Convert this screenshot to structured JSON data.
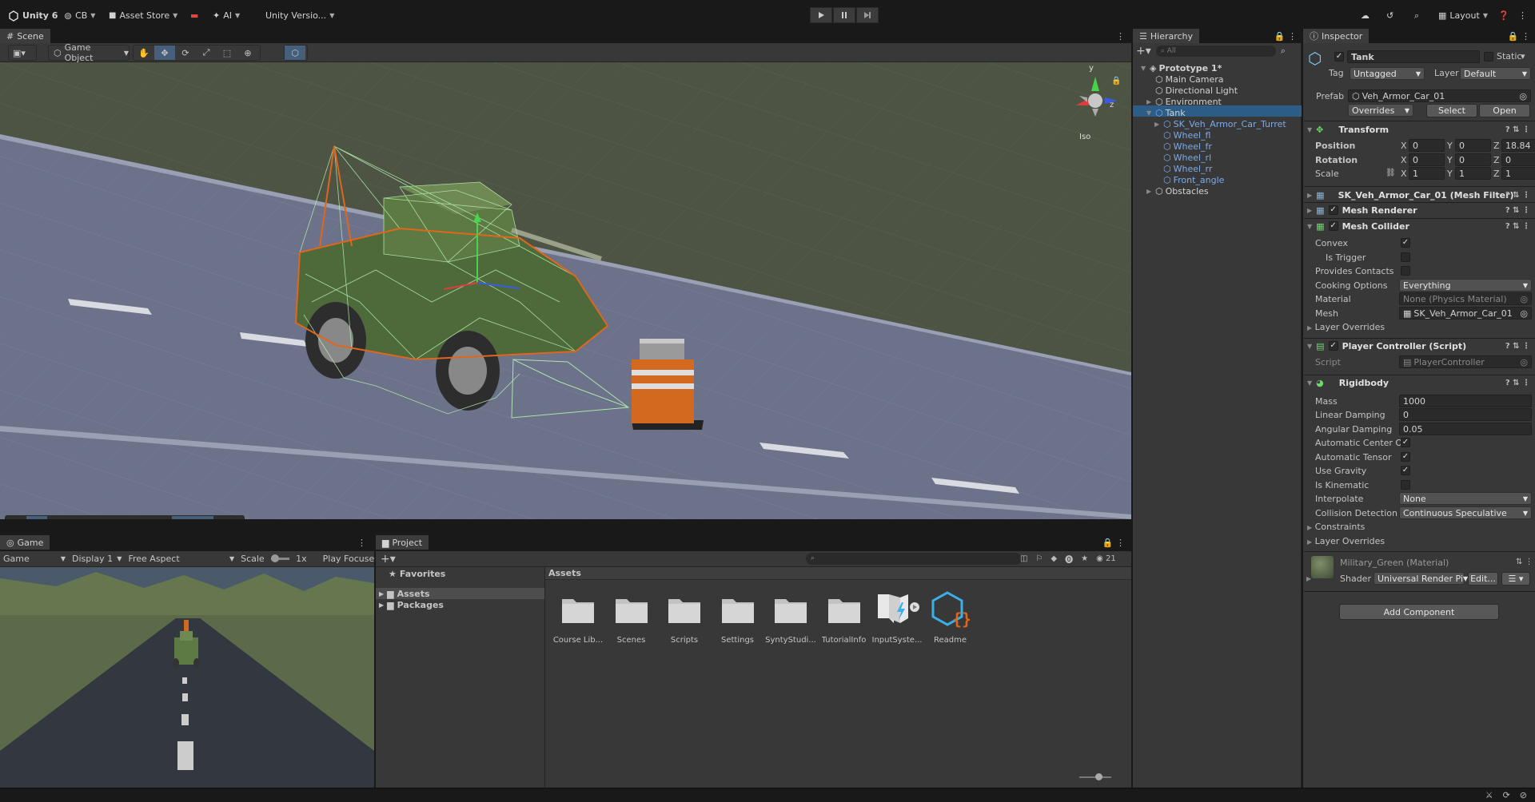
{
  "titlebar": {
    "app": "Unity 6",
    "account": "CB",
    "asset_store": "Asset Store",
    "ai": "AI",
    "version": "Unity Versio...",
    "layout": "Layout"
  },
  "scene": {
    "tab": "Scene",
    "game_object": "Game Object",
    "iso": "Iso",
    "gizmo_y": "y",
    "gizmo_z": "z"
  },
  "game": {
    "tab": "Game",
    "view": "Game",
    "display": "Display 1",
    "aspect": "Free Aspect",
    "scale_label": "Scale",
    "scale_value": "1x",
    "play_mode": "Play Focused"
  },
  "hierarchy": {
    "tab": "Hierarchy",
    "search_placeholder": "All",
    "items": [
      {
        "label": "Prototype 1*"
      },
      {
        "label": "Main Camera"
      },
      {
        "label": "Directional Light"
      },
      {
        "label": "Environment"
      },
      {
        "label": "Tank"
      },
      {
        "label": "SK_Veh_Armor_Car_Turret"
      },
      {
        "label": "Wheel_fl"
      },
      {
        "label": "Wheel_fr"
      },
      {
        "label": "Wheel_rl"
      },
      {
        "label": "Wheel_rr"
      },
      {
        "label": "Front_angle"
      },
      {
        "label": "Obstacles"
      }
    ]
  },
  "project": {
    "tab": "Project",
    "favorites": "Favorites",
    "tree": [
      "Assets",
      "Packages"
    ],
    "breadcrumb": "Assets",
    "count": "21",
    "assets": [
      {
        "name": "Course Lib...",
        "icon": "folder"
      },
      {
        "name": "Scenes",
        "icon": "folder"
      },
      {
        "name": "Scripts",
        "icon": "folder"
      },
      {
        "name": "Settings",
        "icon": "folder"
      },
      {
        "name": "SyntyStudi...",
        "icon": "folder"
      },
      {
        "name": "TutorialInfo",
        "icon": "folder"
      },
      {
        "name": "InputSyste...",
        "icon": "input-system"
      },
      {
        "name": "Readme",
        "icon": "readme"
      }
    ]
  },
  "inspector": {
    "tab": "Inspector",
    "name": "Tank",
    "static": "Static",
    "tag_label": "Tag",
    "tag": "Untagged",
    "layer_label": "Layer",
    "layer": "Default",
    "prefab_label": "Prefab",
    "prefab": "Veh_Armor_Car_01",
    "overrides": "Overrides",
    "select": "Select",
    "open": "Open",
    "transform": {
      "title": "Transform",
      "position": "Position",
      "rotation": "Rotation",
      "scale": "Scale",
      "x": "X",
      "y": "Y",
      "z": "Z",
      "pos": [
        "0",
        "0",
        "18.84"
      ],
      "rot": [
        "0",
        "0",
        "0"
      ],
      "scl": [
        "1",
        "1",
        "1"
      ]
    },
    "mesh_filter": "SK_Veh_Armor_Car_01 (Mesh Filter)",
    "mesh_renderer": "Mesh Renderer",
    "mesh_collider": {
      "title": "Mesh Collider",
      "convex": "Convex",
      "is_trigger": "Is Trigger",
      "provides_contacts": "Provides Contacts",
      "cooking_options": "Cooking Options",
      "cooking_value": "Everything",
      "material": "Material",
      "material_value": "None (Physics Material)",
      "mesh": "Mesh",
      "mesh_value": "SK_Veh_Armor_Car_01",
      "layer_overrides": "Layer Overrides"
    },
    "player_controller": {
      "title": "Player Controller (Script)",
      "script": "Script",
      "script_value": "PlayerController"
    },
    "rigidbody": {
      "title": "Rigidbody",
      "mass": "Mass",
      "mass_value": "1000",
      "linear_damping": "Linear Damping",
      "linear_value": "0",
      "angular_damping": "Angular Damping",
      "angular_value": "0.05",
      "auto_center": "Automatic Center Of",
      "auto_tensor": "Automatic Tensor",
      "use_gravity": "Use Gravity",
      "is_kinematic": "Is Kinematic",
      "interpolate": "Interpolate",
      "interpolate_value": "None",
      "collision": "Collision Detection",
      "collision_value": "Continuous Speculative",
      "constraints": "Constraints",
      "layer_overrides": "Layer Overrides"
    },
    "material": {
      "title": "Military_Green (Material)",
      "shader": "Shader",
      "shader_value": "Universal Render Pi",
      "edit": "Edit..."
    },
    "add_component": "Add Component"
  },
  "colors": {
    "accent": "#46607c",
    "selection": "#2c5d87",
    "blue_text": "#7cabea",
    "orange": "#e0661b"
  }
}
